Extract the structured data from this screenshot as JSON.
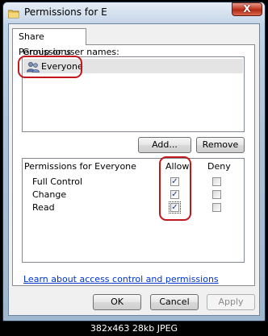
{
  "window": {
    "title": "Permissions for E",
    "close_glyph": "X"
  },
  "tab": {
    "label": "Share Permissions"
  },
  "groups": {
    "label": "Group or user names:",
    "items": [
      {
        "name": "Everyone",
        "icon": "users-icon"
      }
    ]
  },
  "buttons": {
    "add": "Add...",
    "remove": "Remove",
    "ok": "OK",
    "cancel": "Cancel",
    "apply": "Apply"
  },
  "permissions": {
    "label": "Permissions for Everyone",
    "allow_header": "Allow",
    "deny_header": "Deny",
    "rows": [
      {
        "name": "Full Control",
        "allow": true,
        "deny": false
      },
      {
        "name": "Change",
        "allow": true,
        "deny": false
      },
      {
        "name": "Read",
        "allow": true,
        "deny": false
      }
    ],
    "check_glyph": "✓"
  },
  "link": {
    "text": "Learn about access control and permissions"
  },
  "caption": {
    "text": "382x463  28kb  JPEG"
  },
  "colors": {
    "annotation": "#c0181d",
    "link": "#0033cc",
    "close_button": "#c4402a"
  }
}
